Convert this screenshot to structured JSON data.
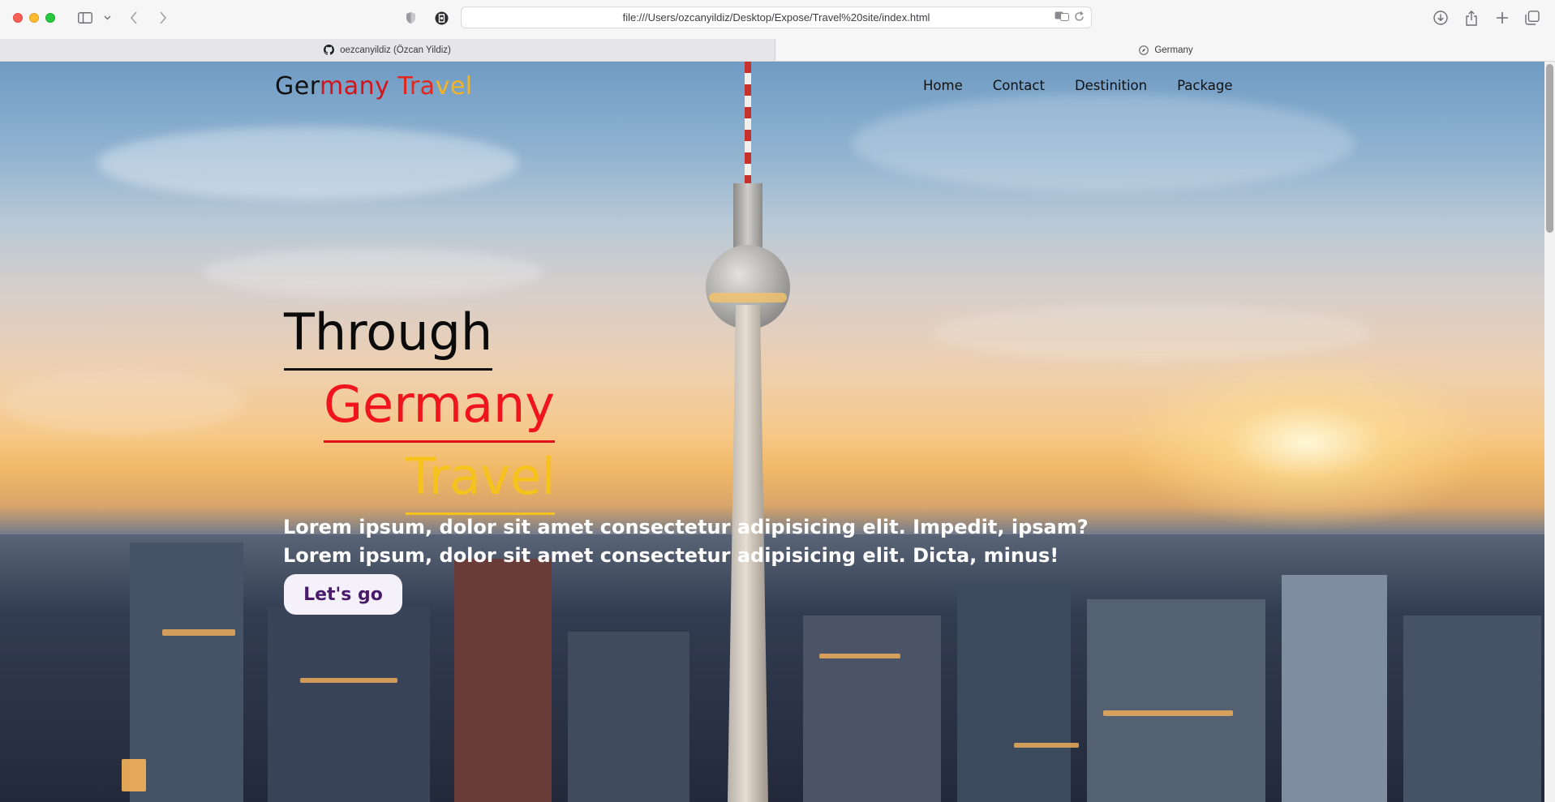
{
  "browser": {
    "address": "file:///Users/ozcanyildiz/Desktop/Expose/Travel%20site/index.html",
    "tabs": [
      {
        "label": "oezcanyildiz (Özcan Yildiz)",
        "icon": "github-icon",
        "active": false
      },
      {
        "label": "Germany",
        "icon": "compass-icon",
        "active": true
      }
    ]
  },
  "site": {
    "logo": {
      "part1": "Ger",
      "part2": "many",
      "part3": " Tra",
      "part4": "vel"
    },
    "nav": [
      "Home",
      "Contact",
      "Destinition",
      "Package"
    ],
    "hero": {
      "line1": "Through",
      "line2": "Germany",
      "line3": "Travel",
      "text": "Lorem ipsum, dolor sit amet consectetur adipisicing elit. Impedit, ipsam? Lorem ipsum, dolor sit amet consectetur adipisicing elit. Dicta, minus!",
      "button": "Let's go"
    }
  },
  "colors": {
    "through": "#0b0b0b",
    "germany": "#f0141c",
    "travel": "#f6c21c",
    "button_text": "#4a1b6b"
  }
}
